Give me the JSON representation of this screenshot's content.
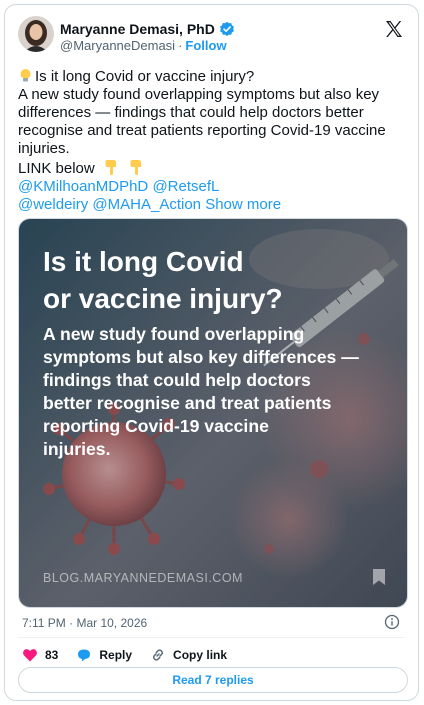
{
  "author": {
    "name": "Maryanne Demasi, PhD",
    "handle": "@MaryanneDemasi",
    "separator": "·",
    "follow_label": "Follow"
  },
  "tweet": {
    "line1": "Is it long Covid or vaccine injury?",
    "line2": "A new study found overlapping symptoms but also key",
    "line3": "differences — findings that could help doctors better",
    "line4": "recognise and treat patients reporting Covid-19 vaccine",
    "line5": "injuries.",
    "line6": "LINK below",
    "mentions": [
      "@KMilhoanMDPhD",
      "@RetsefL",
      "@weldeiry",
      "@MAHA_Action"
    ],
    "show_more": "Show more"
  },
  "media": {
    "title_line1": "Is it long Covid",
    "title_line2": "or vaccine injury?",
    "body_line1": "A new study found overlapping",
    "body_line2": "symptoms but also key differences —",
    "body_line3": "findings that could help doctors",
    "body_line4": "better recognise and treat patients",
    "body_line5": "reporting Covid-19 vaccine",
    "body_line6": "injuries.",
    "site": "BLOG.MARYANNEDEMASI.COM"
  },
  "meta": {
    "timestamp": "7:11 PM · Mar 10, 2026"
  },
  "actions": {
    "like_count": "83",
    "reply_label": "Reply",
    "copy_link_label": "Copy link"
  },
  "replies_button": "Read 7 replies",
  "colors": {
    "accent": "#1d9bf0",
    "like": "#f91880",
    "text": "#0f1419",
    "muted": "#536471"
  },
  "icons": [
    "verified-badge-icon",
    "x-logo-icon",
    "lightbulb-emoji",
    "pointing-down-emoji",
    "bookmark-icon",
    "info-icon",
    "heart-icon",
    "reply-icon",
    "link-icon"
  ]
}
